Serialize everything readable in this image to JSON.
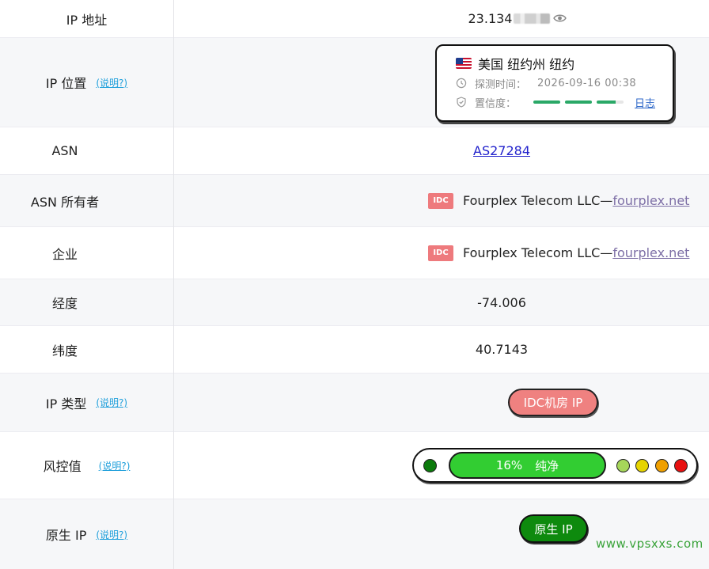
{
  "rows": {
    "ip": {
      "label": "IP 地址",
      "value": "23.134"
    },
    "location": {
      "label": "IP 位置",
      "help": "(说明?)",
      "place": "美国 纽约州 纽约",
      "detect_label": "探测时间：",
      "detect_time": "2026-09-16 00:38",
      "confidence_label": "置信度：",
      "confidence_level": 0.75,
      "log_link": "日志"
    },
    "asn": {
      "label": "ASN",
      "value": "AS27284"
    },
    "asn_owner": {
      "label": "ASN 所有者",
      "tag": "IDC",
      "name": "Fourplex Telecom LLC—",
      "domain": "fourplex.net"
    },
    "company": {
      "label": "企业",
      "tag": "IDC",
      "name": "Fourplex Telecom LLC—",
      "domain": "fourplex.net"
    },
    "longitude": {
      "label": "经度",
      "value": "-74.006"
    },
    "latitude": {
      "label": "纬度",
      "value": "40.7143"
    },
    "ip_type": {
      "label": "IP 类型",
      "help": "(说明?)",
      "value": "IDC机房 IP"
    },
    "risk": {
      "label": "风控值",
      "help": "(说明?)",
      "percent": "16%",
      "status": "纯净",
      "score": 16
    },
    "native": {
      "label": "原生 IP",
      "help": "(说明?)",
      "value": "原生 IP"
    }
  },
  "risk_colors": [
    "#0b7a0b",
    "#a6d65a",
    "#e6d400",
    "#f0a000",
    "#e81010"
  ],
  "watermark": "www.vpsxxs.com"
}
